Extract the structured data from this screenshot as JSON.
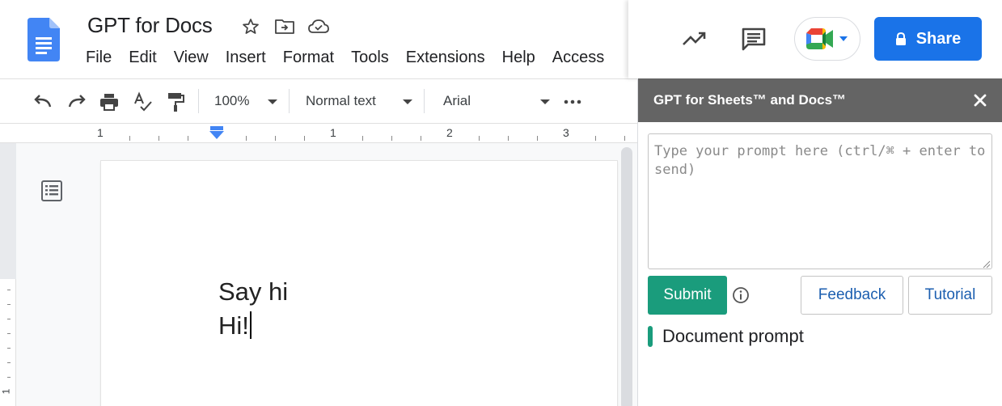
{
  "app": {
    "doc_title": "GPT for Docs",
    "menu": [
      "File",
      "Edit",
      "View",
      "Insert",
      "Format",
      "Tools",
      "Extensions",
      "Help",
      "Access"
    ]
  },
  "toolbar": {
    "zoom": "100%",
    "style": "Normal text",
    "font": "Arial"
  },
  "ruler": {
    "marks": [
      "1",
      "1",
      "2",
      "3"
    ]
  },
  "document": {
    "lines": [
      "Say hi",
      "Hi!"
    ]
  },
  "vertical_ruler": {
    "mark": "1"
  },
  "header_right": {
    "share_label": "Share",
    "brand_color": "#1a73e8"
  },
  "sidebar": {
    "title": "GPT for Sheets™ and Docs™",
    "prompt_placeholder": "Type your prompt here (ctrl/⌘ + enter to send)",
    "prompt_value": "",
    "submit_label": "Submit",
    "feedback_label": "Feedback",
    "tutorial_label": "Tutorial",
    "section_label": "Document prompt",
    "accent_color": "#1a9c7c"
  }
}
